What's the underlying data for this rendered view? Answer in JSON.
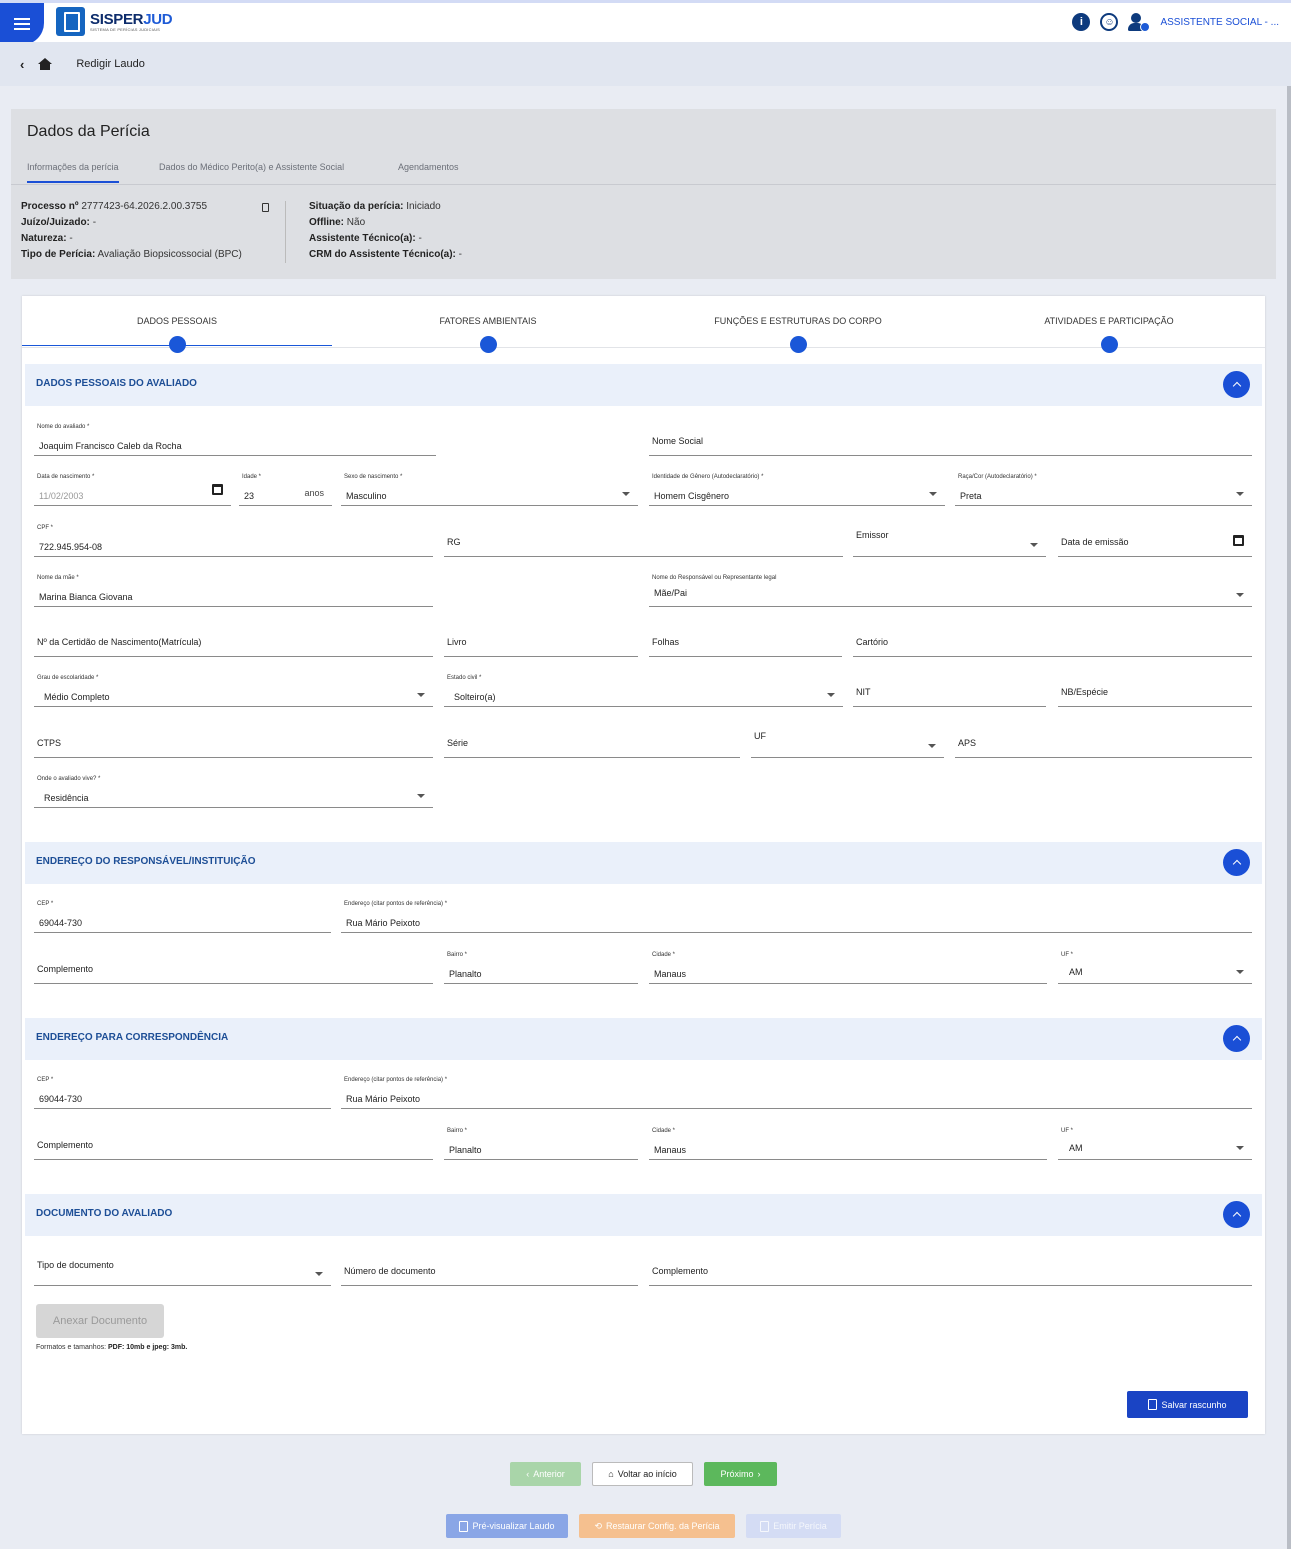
{
  "app": {
    "logo_title_a": "SISPER",
    "logo_title_b": "JUD",
    "logo_subtitle": "SISTEMA DE PERÍCIAS JUDICIAIS",
    "user": "ASSISTENTE SOCIAL - ..."
  },
  "breadcrumb": {
    "page": "Redigir Laudo"
  },
  "header": {
    "title": "Dados da Perícia",
    "tabs": [
      "Informações da perícia",
      "Dados do Médico Perito(a) e Assistente Social",
      "Agendamentos"
    ],
    "info": {
      "processo_label": "Processo nº",
      "processo": "2777423-64.2026.2.00.3755",
      "juizo_label": "Juízo/Juizado:",
      "juizo": "-",
      "natureza_label": "Natureza:",
      "natureza": "-",
      "tipo_label": "Tipo de Perícia:",
      "tipo": "Avaliação Biopsicossocial (BPC)",
      "situacao_label": "Situação da perícia:",
      "situacao": "Iniciado",
      "offline_label": "Offline:",
      "offline": "Não",
      "assistente_label": "Assistente Técnico(a):",
      "assistente": "-",
      "crm_label": "CRM do Assistente Técnico(a):",
      "crm": "-"
    }
  },
  "steps": [
    "DADOS PESSOAIS",
    "FATORES AMBIENTAIS",
    "FUNÇÕES E ESTRUTURAS DO CORPO",
    "ATIVIDADES E PARTICIPAÇÃO"
  ],
  "sections": {
    "pessoais": "DADOS PESSOAIS DO AVALIADO",
    "endereco": "ENDEREÇO DO RESPONSÁVEL/INSTITUIÇÃO",
    "correspondencia": "ENDEREÇO PARA CORRESPONDÊNCIA",
    "documento": "DOCUMENTO DO AVALIADO"
  },
  "fields": {
    "nome_lbl": "Nome do avaliado *",
    "nome": "Joaquim Francisco Caleb da Rocha",
    "nome_social": "Nome Social",
    "nasc_lbl": "Data de nascimento *",
    "nasc": "11/02/2003",
    "idade_lbl": "Idade *",
    "idade": "23",
    "idade_suffix": "anos",
    "sexo_lbl": "Sexo de nascimento *",
    "sexo": "Masculino",
    "genero_lbl": "Identidade de Gênero (Autodeclaratório) *",
    "genero": "Homem Cisgênero",
    "raca_lbl": "Raça/Cor (Autodeclaratório) *",
    "raca": "Preta",
    "cpf_lbl": "CPF *",
    "cpf": "722.945.954-08",
    "rg": "RG",
    "emissor": "Emissor",
    "data_emissao": "Data de emissão",
    "mae_lbl": "Nome da mãe *",
    "mae": "Marina Bianca Giovana",
    "resp_lbl": "Nome do Responsável ou Representante legal",
    "resp": "Mãe/Pai",
    "certidao": "Nº da Certidão de Nascimento(Matrícula)",
    "livro": "Livro",
    "folhas": "Folhas",
    "cartorio": "Cartório",
    "escolaridade_lbl": "Grau de escolaridade *",
    "escolaridade": "Médio Completo",
    "civil_lbl": "Estado civil *",
    "civil": "Solteiro(a)",
    "nit": "NIT",
    "nb": "NB/Espécie",
    "ctps": "CTPS",
    "serie": "Série",
    "uf": "UF",
    "aps": "APS",
    "onde_lbl": "Onde o avaliado vive? *",
    "onde": "Residência",
    "cep_lbl": "CEP *",
    "cep": "69044-730",
    "endereco_lbl": "Endereço (citar pontos de referência) *",
    "endereco": "Rua Mário Peixoto",
    "complemento": "Complemento",
    "bairro_lbl": "Bairro *",
    "bairro": "Planalto",
    "cidade_lbl": "Cidade *",
    "cidade": "Manaus",
    "uf_lbl": "UF *",
    "uf_val": "AM",
    "tipo_doc": "Tipo de documento",
    "numero_doc": "Número de documento"
  },
  "buttons": {
    "anexar": "Anexar Documento",
    "formats_prefix": "Formatos e tamanhos:",
    "formats": "PDF: 10mb e jpeg: 3mb.",
    "salvar": "Salvar rascunho",
    "anterior": "Anterior",
    "voltar": "Voltar ao início",
    "proximo": "Próximo",
    "previsualizar": "Pré-visualizar Laudo",
    "restaurar": "Restaurar Config. da Perícia",
    "emitir": "Emitir Perícia"
  },
  "colors": {
    "primary": "#1a4fd6",
    "section_bg": "#eaf0fa",
    "section_title": "#1d4e96",
    "success": "#5cb85c"
  }
}
